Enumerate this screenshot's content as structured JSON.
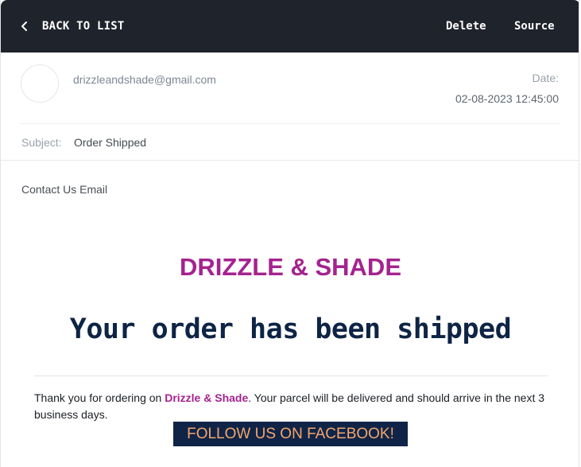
{
  "toolbar": {
    "back_label": "BACK TO LIST",
    "delete_label": "Delete",
    "source_label": "Source"
  },
  "message": {
    "sender": "drizzleandshade@gmail.com",
    "date_label": "Date:",
    "date_value": "02-08-2023 12:45:00",
    "subject_label": "Subject:",
    "subject_value": "Order Shipped"
  },
  "email_body": {
    "preheader": "Contact Us Email",
    "brand": "DRIZZLE & SHADE",
    "headline": "Your order has been shipped",
    "thanks_prefix": "Thank you for ordering on ",
    "thanks_brand": "Drizzle & Shade",
    "thanks_suffix": ". Your parcel will be delivered and should arrive in the next 3 business days.",
    "facebook_button": "FOLLOW US ON FACEBOOK!"
  },
  "icons": {
    "back": "chevron-left-icon"
  },
  "colors": {
    "toolbar_bg": "#1f232c",
    "brand": "#a4238f",
    "headline": "#0e2445",
    "button_bg": "#102447",
    "button_text": "#f4a56c"
  }
}
